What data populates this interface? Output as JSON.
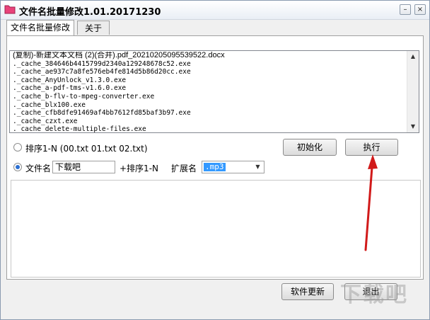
{
  "window": {
    "title": "文件名批量修改1.01.20171230",
    "controls": {
      "minimize": "–",
      "maximize": "□",
      "close": "×"
    }
  },
  "tabs": [
    {
      "label": "文件名批量修改",
      "active": true
    },
    {
      "label": "关于",
      "active": false
    }
  ],
  "file_list": [
    "(复制)-新建文本文档 (2)(合并).pdf_20210205095539522.docx",
    "._cache_384646b4415799d2340a129248678c52.exe",
    "._cache_ae937c7a8fe576eb4fe814d5b86d20cc.exe",
    "._cache_AnyUnlock_v1.3.0.exe",
    "._cache_a-pdf-tms-v1.6.0.exe",
    "._cache_b-flv-to-mpeg-converter.exe",
    "._cache_blx100.exe",
    "._cache_cfb8dfe91469af4bb7612fd85baf3b97.exe",
    "._cache_czxt.exe",
    "._cache_delete-multiple-files.exe"
  ],
  "options": {
    "sort_radio_label": "排序1-N (00.txt  01.txt 02.txt)",
    "sort_selected": false,
    "filename_radio_label": "文件名",
    "filename_selected": true,
    "filename_value": "下载吧",
    "plus_sort_label": "+排序1-N",
    "ext_label": "扩展名",
    "ext_value": ".mp3"
  },
  "buttons": {
    "init": "初始化",
    "execute": "执行",
    "update": "软件更新",
    "exit": "退出"
  },
  "watermark": "下载吧",
  "colors": {
    "accent_blue": "#3399ff",
    "arrow_red": "#d11a1a"
  }
}
